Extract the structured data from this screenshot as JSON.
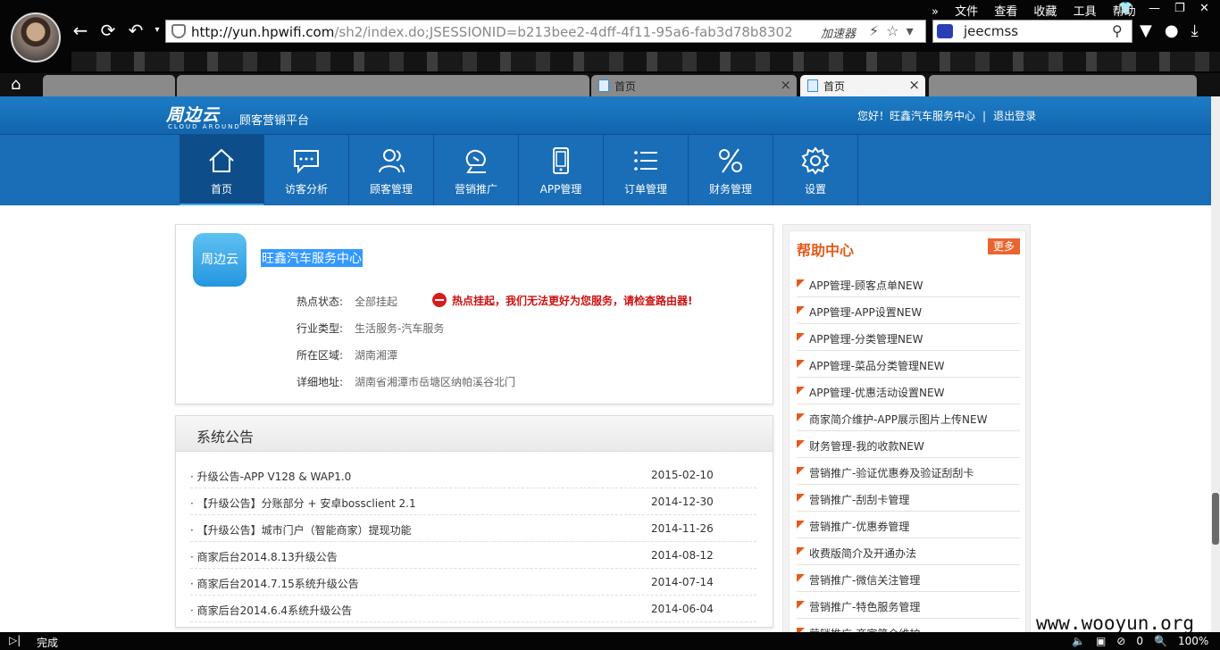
{
  "browser": {
    "url_host": "http://yun.hpwifi.com",
    "url_path": "/sh2/index.do;JSESSIONID=b213bee2-4dff-4f11-95a6-fab3d78b8302",
    "accelerator_label": "加速器",
    "search_text": "jeecmss",
    "menu": [
      "文件",
      "查看",
      "收藏",
      "工具",
      "帮助"
    ],
    "active_tab_title": "首页",
    "inactive_tab_title": "首页",
    "status_text": "完成",
    "status_zoom": "100%",
    "status_count": "0"
  },
  "site": {
    "logo_main": "周边云",
    "logo_sub": "顾客营销平台",
    "logo_en": "CLOUD AROUND",
    "greeting": "您好！旺鑫汽车服务中心",
    "separator": "|",
    "logout": "退出登录",
    "nav": [
      {
        "label": "首页",
        "icon": "home-icon"
      },
      {
        "label": "访客分析",
        "icon": "chat-icon"
      },
      {
        "label": "顾客管理",
        "icon": "users-icon"
      },
      {
        "label": "营销推广",
        "icon": "megaphone-icon"
      },
      {
        "label": "APP管理",
        "icon": "mobile-icon"
      },
      {
        "label": "订单管理",
        "icon": "list-icon"
      },
      {
        "label": "财务管理",
        "icon": "percent-icon"
      },
      {
        "label": "设置",
        "icon": "gear-icon"
      }
    ]
  },
  "business": {
    "logo_text": "周边云",
    "name": "旺鑫汽车服务中心",
    "hotspot_label": "热点状态:",
    "hotspot_value": "全部挂起",
    "alert": "热点挂起，我们无法更好为您服务，请检查路由器!",
    "industry_label": "行业类型:",
    "industry_value": "生活服务-汽车服务",
    "region_label": "所在区域:",
    "region_value": "湖南湘潭",
    "address_label": "详细地址:",
    "address_value": "湖南省湘潭市岳塘区纳帕溪谷北门"
  },
  "notices": {
    "title": "系统公告",
    "items": [
      {
        "text": "· 升级公告-APP V128 & WAP1.0",
        "date": "2015-02-10"
      },
      {
        "text": "· 【升级公告】分账部分 + 安卓bossclient 2.1",
        "date": "2014-12-30"
      },
      {
        "text": "· 【升级公告】城市门户（智能商家）提现功能",
        "date": "2014-11-26"
      },
      {
        "text": "· 商家后台2014.8.13升级公告",
        "date": "2014-08-12"
      },
      {
        "text": "· 商家后台2014.7.15系统升级公告",
        "date": "2014-07-14"
      },
      {
        "text": "· 商家后台2014.6.4系统升级公告",
        "date": "2014-06-04"
      }
    ]
  },
  "help": {
    "title": "帮助中心",
    "more": "更多",
    "items": [
      "APP管理-顾客点单NEW",
      "APP管理-APP设置NEW",
      "APP管理-分类管理NEW",
      "APP管理-菜品分类管理NEW",
      "APP管理-优惠活动设置NEW",
      "商家简介维护-APP展示图片上传NEW",
      "财务管理-我的收款NEW",
      "营销推广-验证优惠券及验证刮刮卡",
      "营销推广-刮刮卡管理",
      "营销推广-优惠券管理",
      "收费版简介及开通办法",
      "营销推广-微信关注管理",
      "营销推广-特色服务管理",
      "营销推广-商家简介维护"
    ]
  },
  "watermark": "www.wooyun.org"
}
